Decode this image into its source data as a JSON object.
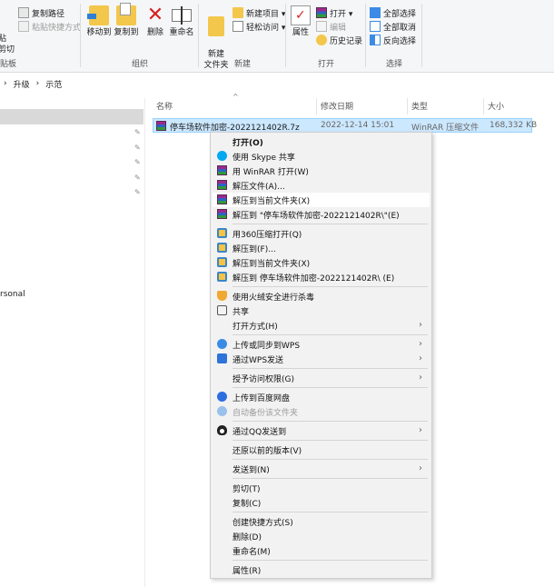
{
  "ribbon": {
    "clipboard": {
      "copy_path": "复制路径",
      "paste_shortcut": "粘贴快捷方式",
      "cut_fragment": "剪切",
      "label": "贴板"
    },
    "organize": {
      "move_to": "移动到",
      "copy_to": "复制到",
      "delete": "删除",
      "rename": "重命名",
      "label": "组织"
    },
    "new": {
      "new_item": "新建项目 ▾",
      "easy_access": "轻松访问 ▾",
      "new_folder": "新建\n文件夹",
      "label": "新建"
    },
    "open": {
      "properties": "属性",
      "open": "打开 ▾",
      "edit": "编辑",
      "history": "历史记录",
      "label": "打开"
    },
    "select": {
      "select_all": "全部选择",
      "select_none": "全部取消",
      "invert": "反向选择",
      "label": "选择"
    }
  },
  "address": {
    "arrow": "›",
    "crumb1": "升级",
    "sep": "›",
    "crumb2": "示范"
  },
  "nav": {
    "partial_text": "rsonal"
  },
  "columns": {
    "name": "名称",
    "modified": "修改日期",
    "type": "类型",
    "size": "大小"
  },
  "file": {
    "name": "停车场软件加密-2022121402R.7z",
    "modified": "2022-12-14 15:01",
    "type": "WinRAR 压缩文件",
    "size": "168,332 KB"
  },
  "context_menu": {
    "items": [
      {
        "label": "打开(O)"
      },
      {
        "label": "使用 Skype 共享"
      },
      {
        "label": "用 WinRAR 打开(W)"
      },
      {
        "label": "解压文件(A)..."
      },
      {
        "label": "解压到当前文件夹(X)"
      },
      {
        "label": "解压到 \"停车场软件加密-2022121402R\\\"(E)"
      },
      {
        "label": "用360压缩打开(Q)"
      },
      {
        "label": "解压到(F)..."
      },
      {
        "label": "解压到当前文件夹(X)"
      },
      {
        "label": "解压到 停车场软件加密-2022121402R\\ (E)"
      },
      {
        "label": "使用火绒安全进行杀毒"
      },
      {
        "label": "共享"
      },
      {
        "label": "打开方式(H)"
      },
      {
        "label": "上传或同步到WPS"
      },
      {
        "label": "通过WPS发送"
      },
      {
        "label": "授予访问权限(G)"
      },
      {
        "label": "上传到百度网盘"
      },
      {
        "label": "自动备份该文件夹"
      },
      {
        "label": "通过QQ发送到"
      },
      {
        "label": "还原以前的版本(V)"
      },
      {
        "label": "发送到(N)"
      },
      {
        "label": "剪切(T)"
      },
      {
        "label": "复制(C)"
      },
      {
        "label": "创建快捷方式(S)"
      },
      {
        "label": "删除(D)"
      },
      {
        "label": "重命名(M)"
      },
      {
        "label": "属性(R)"
      }
    ],
    "submenu_arrow": "›"
  },
  "icons": {
    "pin": "pin-icon"
  },
  "colors": {
    "selection": "#cce8ff",
    "selection_border": "#99d1ff",
    "menu_bg": "#f2f2f2",
    "menu_hover": "#ffffff"
  }
}
